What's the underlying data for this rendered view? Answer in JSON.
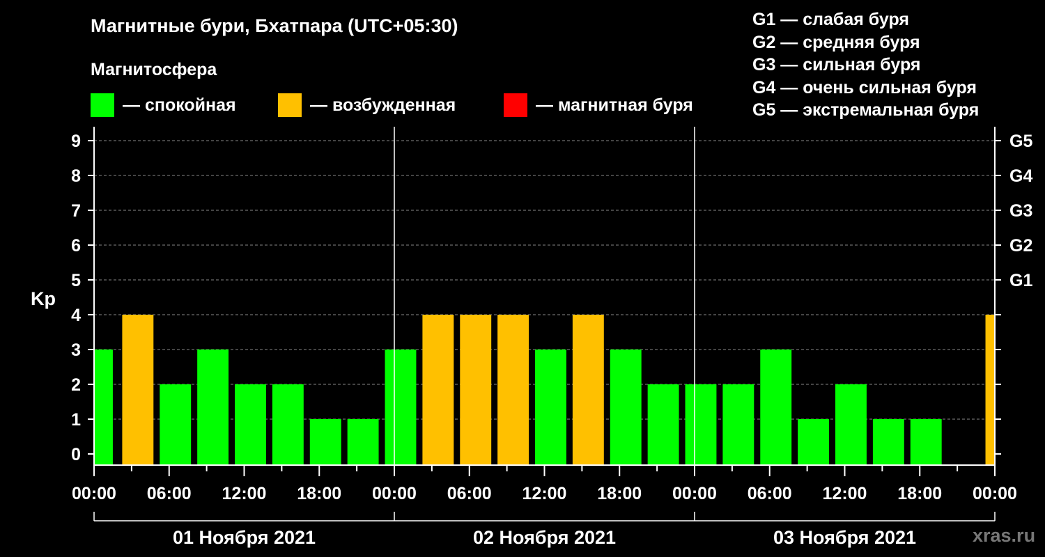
{
  "header": {
    "title": "Магнитные бури, Бхатпара (UTC+05:30)",
    "subtitle": "Магнитосфера"
  },
  "legend": [
    {
      "color": "#00ff00",
      "label": "— спокойная"
    },
    {
      "color": "#ffc000",
      "label": "— возбужденная"
    },
    {
      "color": "#ff0000",
      "label": "— магнитная буря"
    }
  ],
  "storm_levels": [
    "G1 — слабая буря",
    "G2 — средняя буря",
    "G3 — сильная буря",
    "G4 — очень сильная буря",
    "G5 — экстремальная буря"
  ],
  "watermark": "xras.ru",
  "chart_data": {
    "type": "bar",
    "ylabel": "Kp",
    "ylim": [
      0,
      9
    ],
    "yticks": [
      "0",
      "1",
      "2",
      "3",
      "4",
      "5",
      "6",
      "7",
      "8",
      "9"
    ],
    "y2ticks": [
      {
        "kp": 5,
        "label": "G1"
      },
      {
        "kp": 6,
        "label": "G2"
      },
      {
        "kp": 7,
        "label": "G3"
      },
      {
        "kp": 8,
        "label": "G4"
      },
      {
        "kp": 9,
        "label": "G5"
      }
    ],
    "grid": {
      "horizontal": true,
      "style": "dashed"
    },
    "xlim_hours": [
      0,
      72
    ],
    "xticks": [
      {
        "hour": 0,
        "label": "00:00"
      },
      {
        "hour": 6,
        "label": "06:00"
      },
      {
        "hour": 12,
        "label": "12:00"
      },
      {
        "hour": 18,
        "label": "18:00"
      },
      {
        "hour": 24,
        "label": "00:00"
      },
      {
        "hour": 30,
        "label": "06:00"
      },
      {
        "hour": 36,
        "label": "12:00"
      },
      {
        "hour": 42,
        "label": "18:00"
      },
      {
        "hour": 48,
        "label": "00:00"
      },
      {
        "hour": 54,
        "label": "06:00"
      },
      {
        "hour": 60,
        "label": "12:00"
      },
      {
        "hour": 66,
        "label": "18:00"
      },
      {
        "hour": 72,
        "label": "00:00"
      }
    ],
    "days": [
      "01 Ноября 2021",
      "02 Ноября 2021",
      "03 Ноября 2021"
    ],
    "colors": {
      "quiet": "#00ff00",
      "active": "#ffc000",
      "storm": "#ff0000"
    },
    "bars": [
      {
        "start": 0,
        "end": 1.5,
        "kp": 3,
        "level": "quiet"
      },
      {
        "start": 2.25,
        "end": 4.75,
        "kp": 4,
        "level": "active"
      },
      {
        "start": 5.25,
        "end": 7.75,
        "kp": 2,
        "level": "quiet"
      },
      {
        "start": 8.25,
        "end": 10.75,
        "kp": 3,
        "level": "quiet"
      },
      {
        "start": 11.25,
        "end": 13.75,
        "kp": 2,
        "level": "quiet"
      },
      {
        "start": 14.25,
        "end": 16.75,
        "kp": 2,
        "level": "quiet"
      },
      {
        "start": 17.25,
        "end": 19.75,
        "kp": 1,
        "level": "quiet"
      },
      {
        "start": 20.25,
        "end": 22.75,
        "kp": 1,
        "level": "quiet"
      },
      {
        "start": 23.25,
        "end": 25.75,
        "kp": 3,
        "level": "quiet"
      },
      {
        "start": 26.25,
        "end": 28.75,
        "kp": 4,
        "level": "active"
      },
      {
        "start": 29.25,
        "end": 31.75,
        "kp": 4,
        "level": "active"
      },
      {
        "start": 32.25,
        "end": 34.75,
        "kp": 4,
        "level": "active"
      },
      {
        "start": 35.25,
        "end": 37.75,
        "kp": 3,
        "level": "quiet"
      },
      {
        "start": 38.25,
        "end": 40.75,
        "kp": 4,
        "level": "active"
      },
      {
        "start": 41.25,
        "end": 43.75,
        "kp": 3,
        "level": "quiet"
      },
      {
        "start": 44.25,
        "end": 46.75,
        "kp": 2,
        "level": "quiet"
      },
      {
        "start": 47.25,
        "end": 49.75,
        "kp": 2,
        "level": "quiet"
      },
      {
        "start": 50.25,
        "end": 52.75,
        "kp": 2,
        "level": "quiet"
      },
      {
        "start": 53.25,
        "end": 55.75,
        "kp": 3,
        "level": "quiet"
      },
      {
        "start": 56.25,
        "end": 58.75,
        "kp": 1,
        "level": "quiet"
      },
      {
        "start": 59.25,
        "end": 61.75,
        "kp": 2,
        "level": "quiet"
      },
      {
        "start": 62.25,
        "end": 64.75,
        "kp": 1,
        "level": "quiet"
      },
      {
        "start": 65.25,
        "end": 67.75,
        "kp": 1,
        "level": "quiet"
      },
      {
        "start": 71.25,
        "end": 72,
        "kp": 4,
        "level": "active"
      }
    ]
  }
}
